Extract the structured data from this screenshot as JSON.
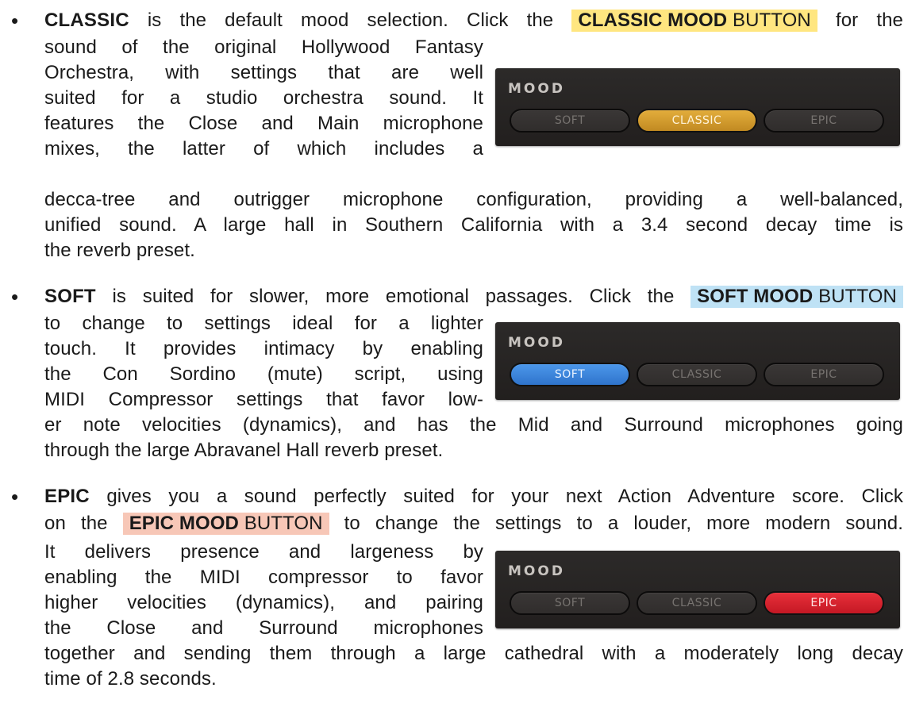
{
  "classic": {
    "bullet": "•",
    "keyword": "CLASSIC",
    "line1_a": " is the default mood selection. Click the",
    "button_bold": "CLASSIC MOOD",
    "button_rest": " BUTTON",
    "line1_b": "for the",
    "lines_narrow": [
      "sound of the original Hollywood Fantasy",
      "Orchestra, with settings that are well",
      "suited for a studio orchestra sound. It",
      "features the Close and Main microphone",
      "mixes, the latter of which includes a"
    ],
    "lines_wide": [
      "decca-tree and outrigger microphone configuration, providing a well-balanced,",
      "unified sound. A large  hall in Southern California with a 3.4 second decay time is"
    ],
    "line_last": "the reverb preset.",
    "highlight_color": "#ffe680"
  },
  "soft": {
    "bullet": "•",
    "keyword": "SOFT",
    "line1_a": " is suited for slower, more emotional passages. Click the",
    "button_bold": "SOFT MOOD",
    "button_rest": " BUTTON",
    "lines_narrow": [
      "to change to settings ideal for a lighter",
      "touch. It provides intimacy by enabling",
      "the Con Sordino (mute) script, using",
      "MIDI Compressor settings that favor low-"
    ],
    "lines_wide": [
      "er note velocities (dynamics), and has the Mid and Surround microphones going"
    ],
    "line_last": "through the large Abravanel Hall reverb preset.",
    "highlight_color": "#bfe2f5"
  },
  "epic": {
    "bullet": "•",
    "keyword": "EPIC",
    "line1_rest": " gives you a sound perfectly suited for your next Action Adventure score. Click",
    "line2_a": "on the",
    "button_bold": "EPIC MOOD",
    "button_rest": " BUTTON",
    "line2_b": "to change the settings to a louder, more modern sound.",
    "lines_narrow": [
      "It delivers presence and largeness by",
      "enabling the MIDI compressor to favor",
      "higher velocities (dynamics), and pairing",
      "the Close and Surround microphones"
    ],
    "lines_wide": [
      "together and sending them through a large cathedral with a moderately long decay"
    ],
    "line_last": "time of 2.8 seconds.",
    "highlight_color": "#f7c7b7"
  },
  "mood_panel": {
    "title": "MOOD",
    "buttons": [
      "SOFT",
      "CLASSIC",
      "EPIC"
    ],
    "colors": {
      "classic": "#d9a030",
      "soft": "#3d87e0",
      "epic": "#dc2430",
      "inactive": "#332f2e"
    }
  }
}
